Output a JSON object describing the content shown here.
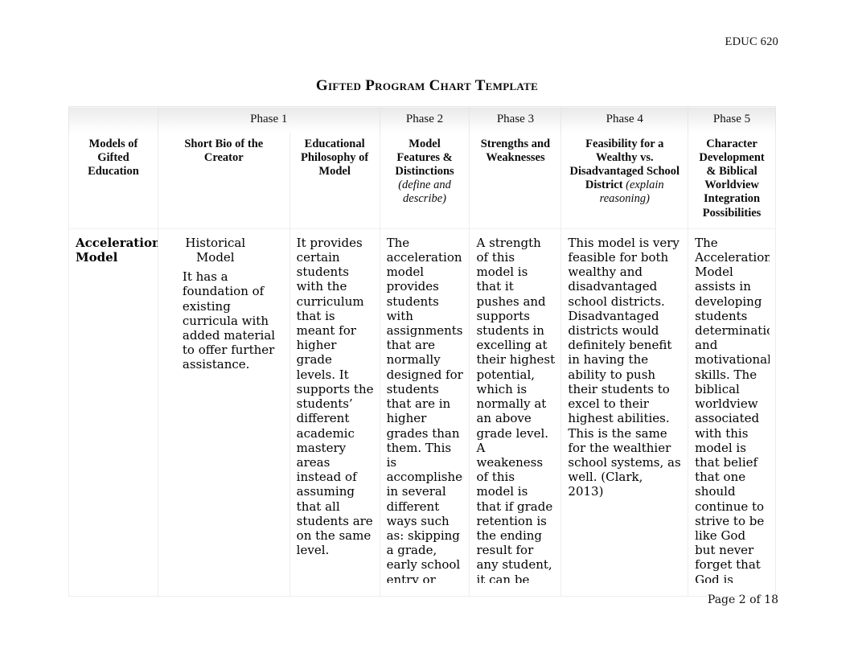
{
  "header": {
    "course_code": "EDUC 620"
  },
  "title": "Gifted Program Chart Template",
  "footer": {
    "page_label": "Page 2 of 18"
  },
  "table": {
    "phases": [
      "",
      "",
      "Phase 1",
      "",
      "Phase 2",
      "Phase 3",
      "Phase 4",
      "Phase 5"
    ],
    "phase_cells": [
      {
        "label": "",
        "span": 1
      },
      {
        "label": "Phase 1",
        "span": 1
      },
      {
        "label": "Phase 2",
        "span": 1
      },
      {
        "label": "Phase 3",
        "span": 1
      },
      {
        "label": "Phase 4",
        "span": 1
      },
      {
        "label": "Phase 5",
        "span": 1
      }
    ],
    "phase_row": {
      "blank": "",
      "p1": "Phase 1",
      "p2": "Phase 2",
      "p3": "Phase 3",
      "p4": "Phase 4",
      "p5": "Phase 5"
    },
    "headers": {
      "models": "Models of Gifted Education",
      "bio": "Short Bio of the Creator",
      "philosophy": "Educational Philosophy of Model",
      "features_main": "Model Features & Distinctions",
      "features_paren": "(define and describe)",
      "strengths": "Strengths and Weaknesses",
      "feasibility_main": "Feasibility for a Wealthy vs. Disadvantaged School District ",
      "feasibility_paren": "(explain reasoning)",
      "character": "Character Development & Biblical Worldview Integration Possibilities"
    },
    "rows": [
      {
        "model": "Acceleration Model",
        "bio_title": "Historical Model",
        "bio_body": "It has a foundation of existing curricula with added material to offer further assistance.",
        "philosophy": "It provides certain students with the curriculum that is meant for higher grade levels. It supports the students’ different academic mastery areas instead of assuming that all students are on the same level.",
        "features": "The acceleration model provides students with assignments that are normally designed for students that are in higher grades than them. This is accomplished in several different ways such as: skipping a grade, early school entry or advancement placement for those students",
        "strengths": "A strength of this model is that it pushes and supports students in excelling at their highest potential, which is normally at an above grade level. A weakeness of this model is that if grade retention is the ending result for any student, it can be very harmful to the student mentally. (DeLacy,",
        "feasibility": "This model is very feasible for both wealthy and disadvantaged school districts. Disadvantaged districts would definitely benefit in having the ability to push their students to excel to their highest abilities. This is the same for the wealthier school systems, as well. (Clark, 2013)",
        "character": "The Acceleration Model assists in developing students determination and motivational skills. The biblical worldview associated with this model is that belief that one should continue to strive to be like God but never forget that God is Omniscient. He knows all things."
      }
    ]
  },
  "colors": {
    "page_background": "#ffffff",
    "text": "#000000",
    "table_border": "#ededed",
    "phase_band": "#e9e9e9"
  }
}
